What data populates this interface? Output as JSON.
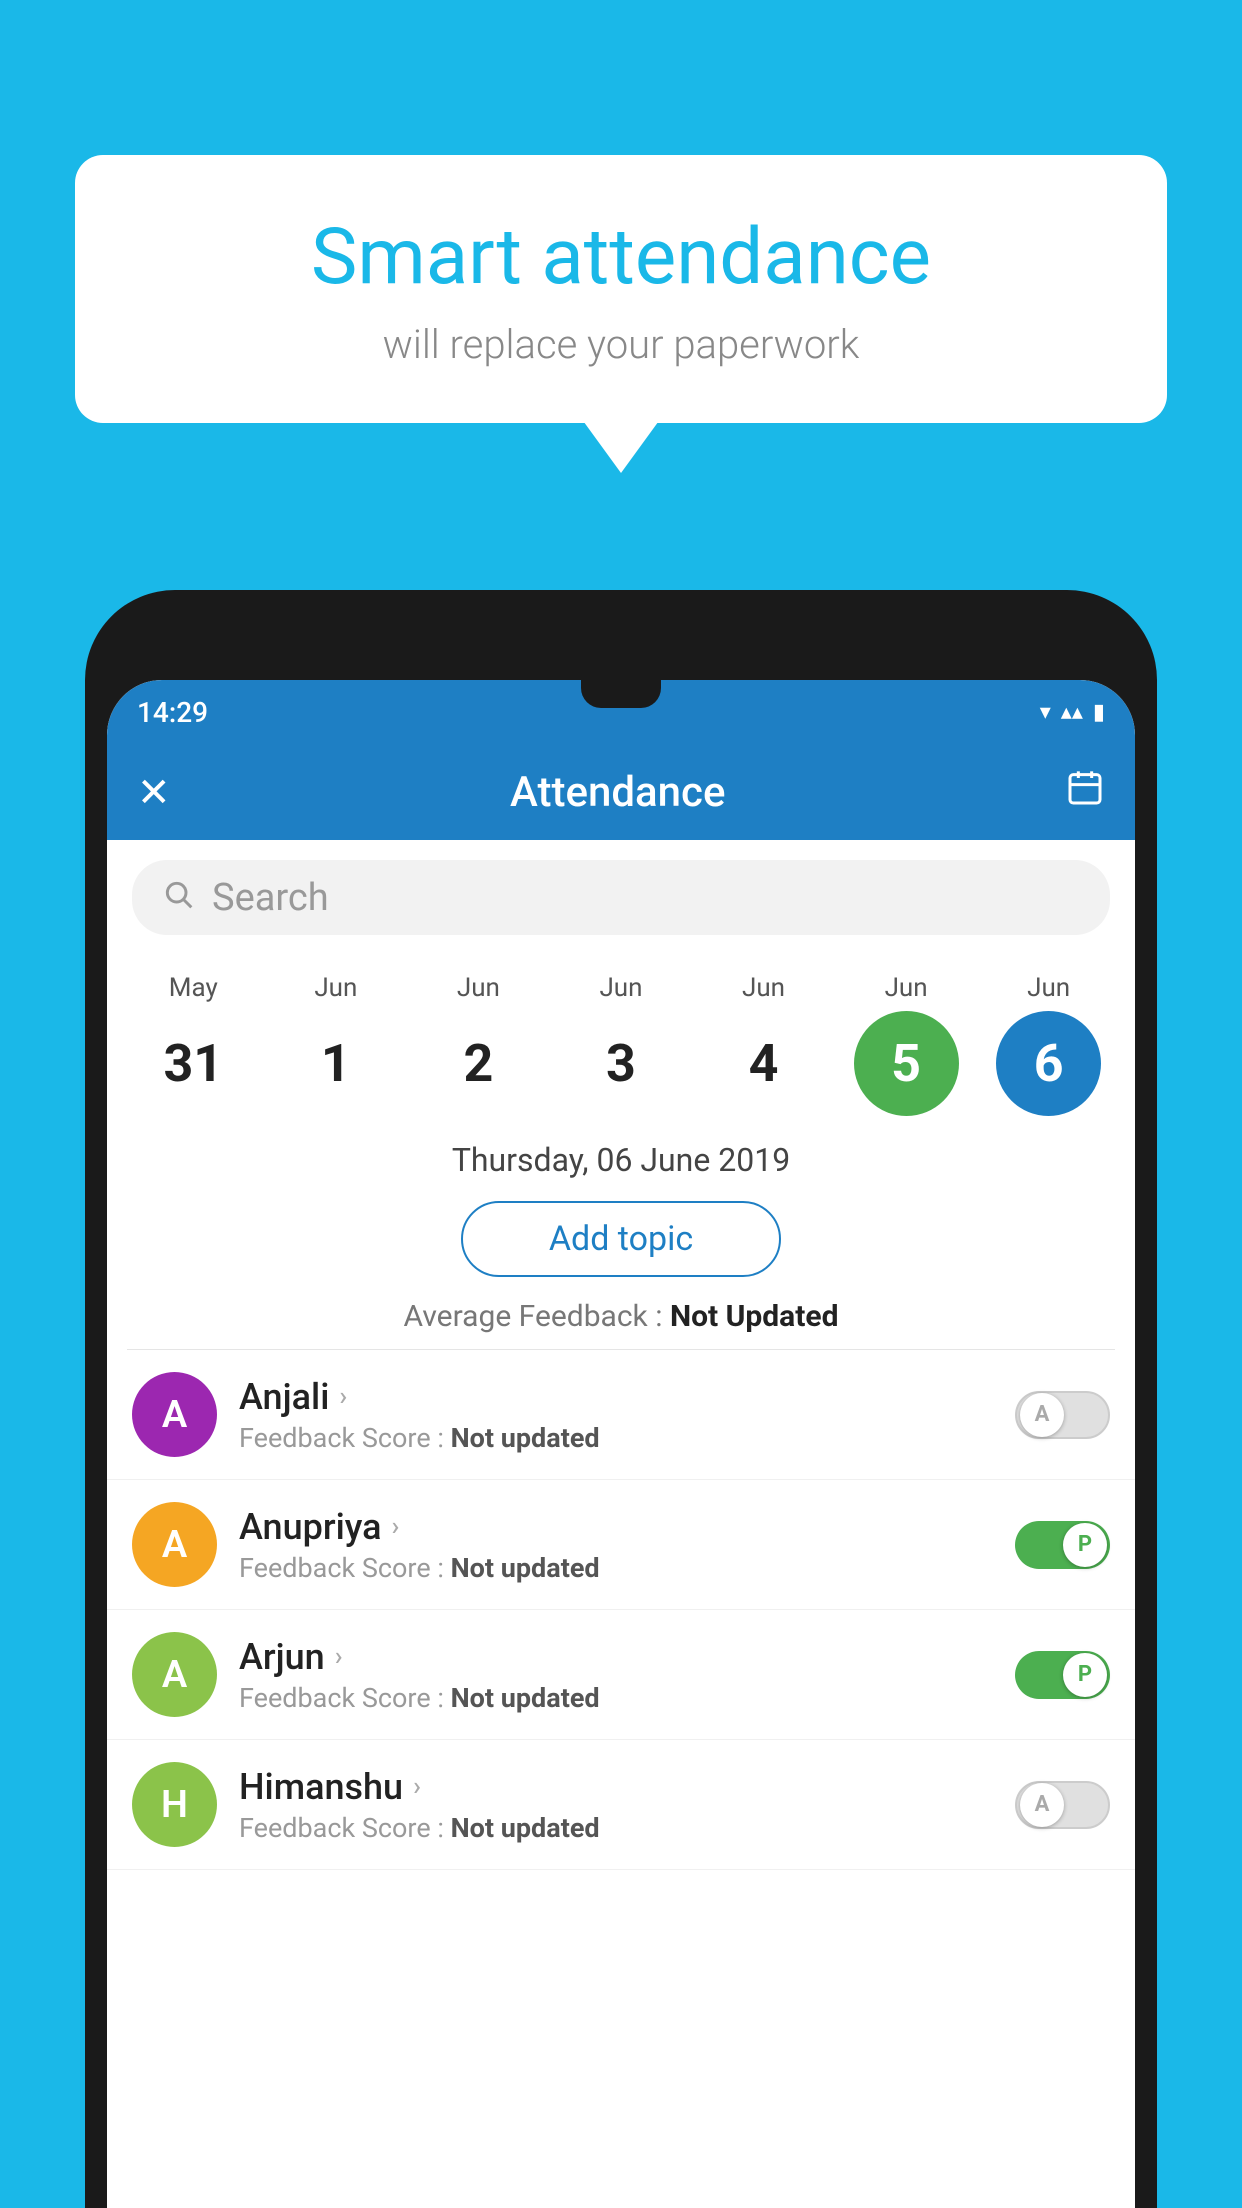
{
  "background": {
    "color": "#1ab8e8"
  },
  "speech_bubble": {
    "title": "Smart attendance",
    "subtitle": "will replace your paperwork"
  },
  "status_bar": {
    "time": "14:29",
    "wifi_icon": "▼",
    "signal_icon": "▲",
    "battery_icon": "▮"
  },
  "app_header": {
    "close_label": "✕",
    "title": "Attendance",
    "calendar_icon": "📅"
  },
  "search": {
    "placeholder": "Search"
  },
  "calendar": {
    "days": [
      {
        "month": "May",
        "date": "31",
        "state": "normal"
      },
      {
        "month": "Jun",
        "date": "1",
        "state": "normal"
      },
      {
        "month": "Jun",
        "date": "2",
        "state": "normal"
      },
      {
        "month": "Jun",
        "date": "3",
        "state": "normal"
      },
      {
        "month": "Jun",
        "date": "4",
        "state": "normal"
      },
      {
        "month": "Jun",
        "date": "5",
        "state": "today"
      },
      {
        "month": "Jun",
        "date": "6",
        "state": "selected"
      }
    ]
  },
  "selected_date": "Thursday, 06 June 2019",
  "add_topic_label": "Add topic",
  "feedback_summary_label": "Average Feedback :",
  "feedback_summary_value": "Not Updated",
  "students": [
    {
      "name": "Anjali",
      "avatar_letter": "A",
      "avatar_color": "#9c27b0",
      "feedback_label": "Feedback Score :",
      "feedback_value": "Not updated",
      "toggle": "off",
      "toggle_letter": "A"
    },
    {
      "name": "Anupriya",
      "avatar_letter": "A",
      "avatar_color": "#f5a623",
      "feedback_label": "Feedback Score :",
      "feedback_value": "Not updated",
      "toggle": "on",
      "toggle_letter": "P"
    },
    {
      "name": "Arjun",
      "avatar_letter": "A",
      "avatar_color": "#8bc34a",
      "feedback_label": "Feedback Score :",
      "feedback_value": "Not updated",
      "toggle": "on",
      "toggle_letter": "P"
    },
    {
      "name": "Himanshu",
      "avatar_letter": "H",
      "avatar_color": "#8bc34a",
      "feedback_label": "Feedback Score :",
      "feedback_value": "Not updated",
      "toggle": "off",
      "toggle_letter": "A"
    }
  ]
}
